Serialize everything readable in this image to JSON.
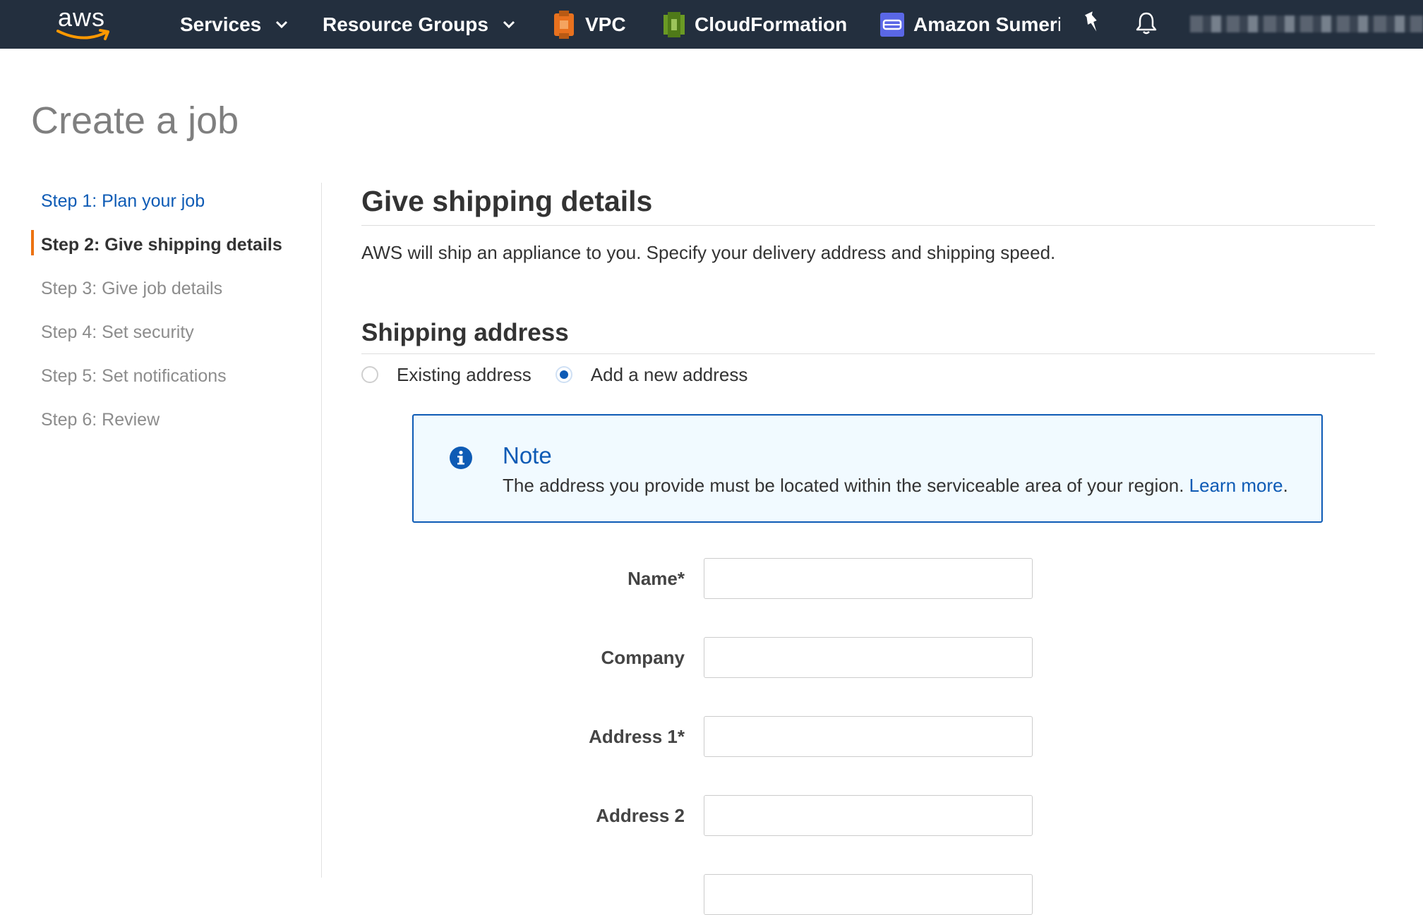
{
  "topnav": {
    "logo_text": "aws",
    "services_label": "Services",
    "resource_groups_label": "Resource Groups",
    "pinned": [
      {
        "label": "VPC",
        "icon": "vpc-icon",
        "color": "#e8711e"
      },
      {
        "label": "CloudFormation",
        "icon": "cloudformation-icon",
        "color": "#6a9a24"
      },
      {
        "label": "Amazon Sumerian",
        "icon": "sumerian-icon",
        "color": "#5a67e6"
      }
    ],
    "account_label_blurred": true
  },
  "page": {
    "title": "Create a job"
  },
  "steps": [
    {
      "label": "Step 1: Plan your job",
      "state": "link"
    },
    {
      "label": "Step 2: Give shipping details",
      "state": "active"
    },
    {
      "label": "Step 3: Give job details",
      "state": "disabled"
    },
    {
      "label": "Step 4: Set security",
      "state": "disabled"
    },
    {
      "label": "Step 5: Set notifications",
      "state": "disabled"
    },
    {
      "label": "Step 6: Review",
      "state": "disabled"
    }
  ],
  "main": {
    "section_title": "Give shipping details",
    "description": "AWS will ship an appliance to you. Specify your delivery address and shipping speed.",
    "shipping_title": "Shipping address",
    "address_options": [
      {
        "label": "Existing address",
        "checked": false
      },
      {
        "label": "Add a new address",
        "checked": true
      }
    ],
    "note": {
      "title": "Note",
      "text": "The address you provide must be located within the serviceable area of your region.",
      "link": "Learn more",
      "trailing": "."
    },
    "form": {
      "name_label": "Name*",
      "name_value": "",
      "company_label": "Company",
      "company_value": "",
      "address1_label": "Address 1*",
      "address1_value": "",
      "address2_label": "Address 2",
      "address2_value": ""
    }
  },
  "colors": {
    "nav_bg": "#232f3e",
    "link": "#0e5bb5",
    "active_step_marker": "#ec7211",
    "note_bg": "#f1faff"
  }
}
